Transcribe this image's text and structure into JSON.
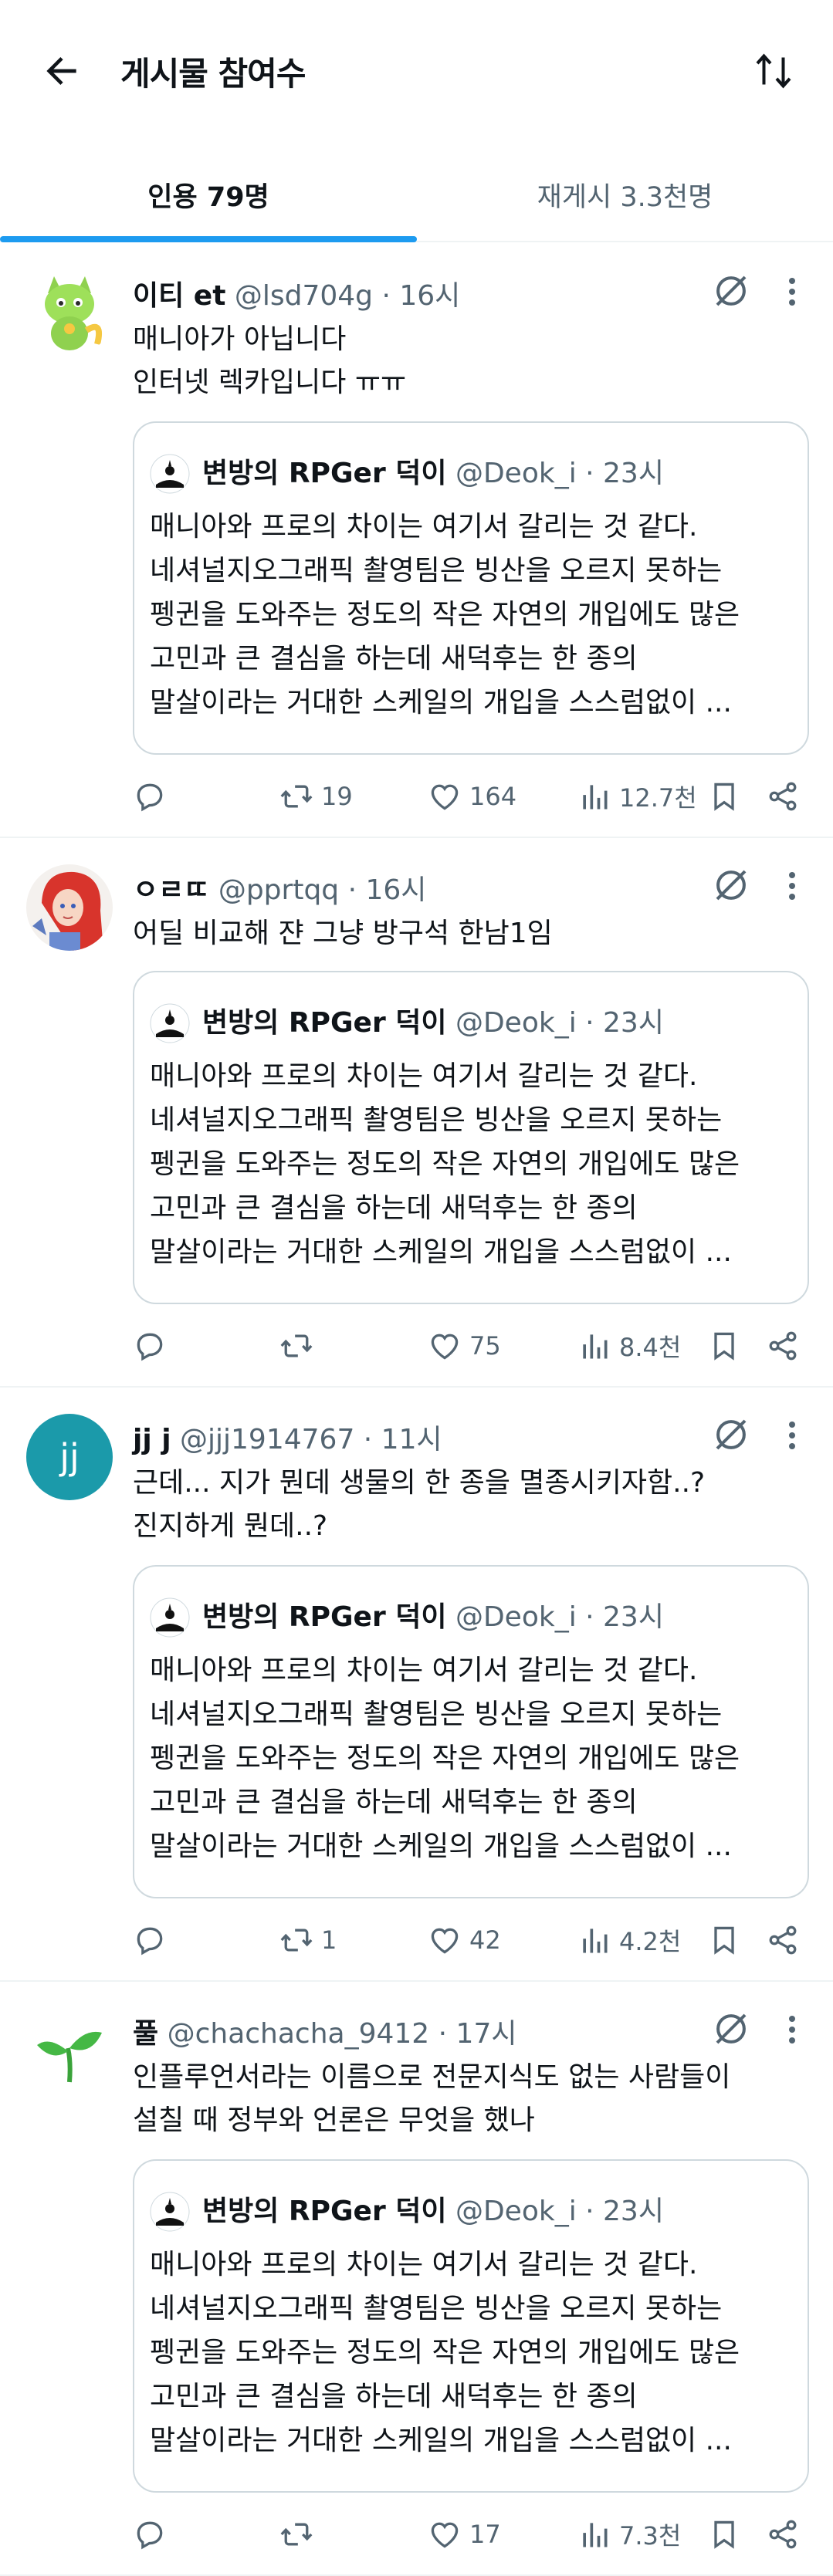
{
  "header": {
    "title": "게시물 참여수"
  },
  "tabs": [
    {
      "label": "인용 79명",
      "active": true
    },
    {
      "label": "재게시 3.3천명",
      "active": false
    }
  ],
  "colors": {
    "accent": "#1d9bf0",
    "secondary_text": "#536471"
  },
  "quoted": {
    "name": "변방의 RPGer 덕이",
    "handle_time": "@Deok_i · 23시",
    "lines": [
      "매니아와 프로의 차이는 여기서 갈리는 것 같다.",
      "네셔널지오그래픽 촬영팀은 빙산을 오르지 못하는",
      "펭귄을 도와주는 정도의 작은 자연의 개입에도 많은",
      "고민과 큰 결심을 하는데 새덕후는 한 종의",
      "말살이라는 거대한 스케일의 개입을 스스럼없이 ..."
    ]
  },
  "posts": [
    {
      "name": "이티 et",
      "handle_time": "@lsd704g · 16시",
      "avatar_icon": "green-cat-avatar",
      "text": [
        "매니아가 아닙니다",
        "인터넷 렉카입니다 ㅠㅠ"
      ],
      "replies": "",
      "retweets": "19",
      "likes": "164",
      "views": "12.7천"
    },
    {
      "name": "ㅇㄹㄸ",
      "handle_time": "@pprtqq · 16시",
      "avatar_icon": "red-hair-girl-avatar",
      "text": [
        "어딜 비교해 쟌 그냥 방구석 한남1임"
      ],
      "replies": "",
      "retweets": "",
      "likes": "75",
      "views": "8.4천"
    },
    {
      "name": "jj j",
      "handle_time": "@jjj1914767 · 11시",
      "avatar_icon": "jj-letter-avatar",
      "avatar_letters": "jj",
      "text": [
        "근데... 지가 뭔데 생물의 한 종을 멸종시키자함..?",
        "진지하게 뭔데..?"
      ],
      "replies": "",
      "retweets": "1",
      "likes": "42",
      "views": "4.2천"
    },
    {
      "name": "풀",
      "handle_time": "@chachacha_9412 · 17시",
      "avatar_icon": "sprout-avatar",
      "text": [
        "인플루언서라는 이름으로 전문지식도 없는 사람들이",
        "설칠 때 정부와 언론은 무엇을 했나"
      ],
      "replies": "",
      "retweets": "",
      "likes": "17",
      "views": "7.3천"
    }
  ]
}
